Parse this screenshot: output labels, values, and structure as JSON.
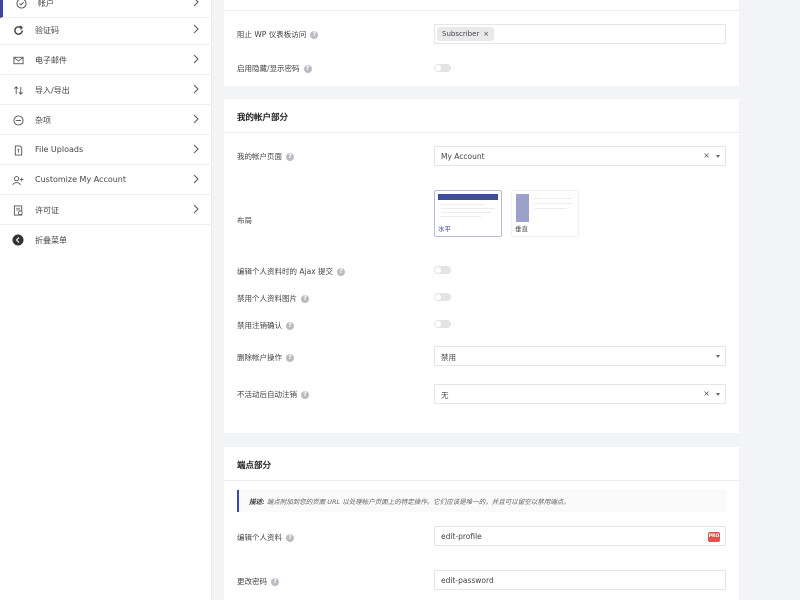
{
  "sidebar": {
    "items": [
      {
        "label": "帐户",
        "icon": "shield-check-icon",
        "active": true
      },
      {
        "label": "验证码",
        "icon": "refresh-icon"
      },
      {
        "label": "电子邮件",
        "icon": "envelope-icon"
      },
      {
        "label": "导入/导出",
        "icon": "sort-arrows-icon"
      },
      {
        "label": "杂项",
        "icon": "minus-circle-icon"
      },
      {
        "label": "File Uploads",
        "icon": "file-icon"
      },
      {
        "label": "Customize My Account",
        "icon": "user-plus-icon"
      },
      {
        "label": "许可证",
        "icon": "license-icon"
      },
      {
        "label": "折叠菜单",
        "icon": "collapse-circle-icon"
      }
    ]
  },
  "top_card": {
    "block_wp_label": "阻止 WP 仪表板访问",
    "block_wp_tag": "Subscriber",
    "tag_remove": "×",
    "password_toggle_label": "启用隐藏/显示密码"
  },
  "account_card": {
    "title": "我的帐户部分",
    "page_label": "我的帐户页面",
    "page_value": "My Account",
    "layout_label": "布局",
    "layout_options": [
      {
        "label": "水平",
        "selected": true
      },
      {
        "label": "垂直",
        "selected": false
      }
    ],
    "ajax_label": "编辑个人资料时的 Ajax 提交",
    "disable_picture_label": "禁用个人资料图片",
    "disable_logout_confirm_label": "禁用注销确认",
    "delete_action_label": "删除帐户操作",
    "delete_action_value": "禁用",
    "inactive_logout_label": "不活动后自动注销",
    "inactive_logout_value": "无",
    "clear_symbol": "×"
  },
  "endpoint_card": {
    "title": "端点部分",
    "notice_lead": "描述:",
    "notice_text": "端点附加到您的页面 URL 以处理帐户页面上的特定操作。它们应该是唯一的，并且可以留空以禁用端点。",
    "edit_profile_label": "编辑个人资料",
    "edit_profile_value": "edit-profile",
    "change_password_label": "更改密码",
    "change_password_value": "edit-password",
    "lock_badge": "PRO"
  },
  "colors": {
    "accent": "#3b46a6",
    "page_bg": "#f3f4f6",
    "card_bg": "#ffffff",
    "toggle_off": "#e4e4e7",
    "badge_red": "#e05252"
  }
}
